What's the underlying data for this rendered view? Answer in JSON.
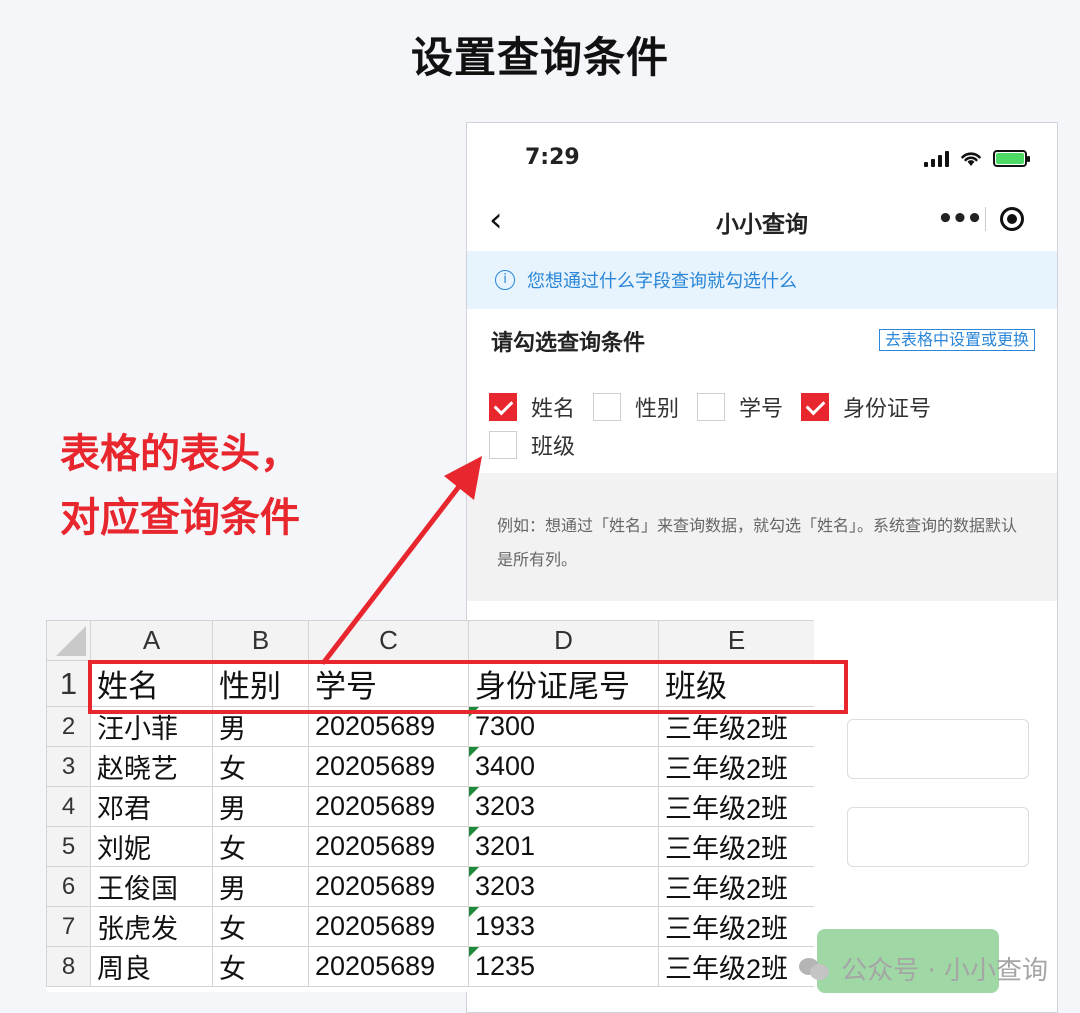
{
  "page_title": "设置查询条件",
  "phone": {
    "status_time": "7:29",
    "nav_title": "小小查询",
    "back_glyph": "‹",
    "more_glyph": "•••",
    "info_text": "您想通过什么字段查询就勾选什么",
    "cond_title": "请勾选查询条件",
    "change_link": "去表格中设置或更换",
    "checkboxes": [
      {
        "label": "姓名",
        "checked": true
      },
      {
        "label": "性别",
        "checked": false
      },
      {
        "label": "学号",
        "checked": false
      },
      {
        "label": "身份证号",
        "checked": true
      },
      {
        "label": "班级",
        "checked": false
      }
    ],
    "hint_text": "例如：想通过「姓名」来查询数据，就勾选「姓名」。系统查询的数据默认是所有列。",
    "accent_color": "#e8262d",
    "info_color": "#2a86d8",
    "submit_color": "#9fd7a5"
  },
  "annotation": {
    "line1": "表格的表头，",
    "line2": "对应查询条件"
  },
  "sheet": {
    "columns": [
      "A",
      "B",
      "C",
      "D",
      "E"
    ],
    "header": [
      "姓名",
      "性别",
      "学号",
      "身份证尾号",
      "班级"
    ],
    "rows": [
      {
        "num": "2",
        "cells": [
          "汪小菲",
          "男",
          "20205689",
          "7300",
          "三年级2班"
        ]
      },
      {
        "num": "3",
        "cells": [
          "赵晓艺",
          "女",
          "20205689",
          "3400",
          "三年级2班"
        ]
      },
      {
        "num": "4",
        "cells": [
          "邓君",
          "男",
          "20205689",
          "3203",
          "三年级2班"
        ]
      },
      {
        "num": "5",
        "cells": [
          "刘妮",
          "女",
          "20205689",
          "3201",
          "三年级2班"
        ]
      },
      {
        "num": "6",
        "cells": [
          "王俊国",
          "男",
          "20205689",
          "3203",
          "三年级2班"
        ]
      },
      {
        "num": "7",
        "cells": [
          "张虎发",
          "女",
          "20205689",
          "1933",
          "三年级2班"
        ]
      },
      {
        "num": "8",
        "cells": [
          "周良",
          "女",
          "20205689",
          "1235",
          "三年级2班"
        ]
      }
    ]
  },
  "watermark": "公众号 · 小小查询"
}
